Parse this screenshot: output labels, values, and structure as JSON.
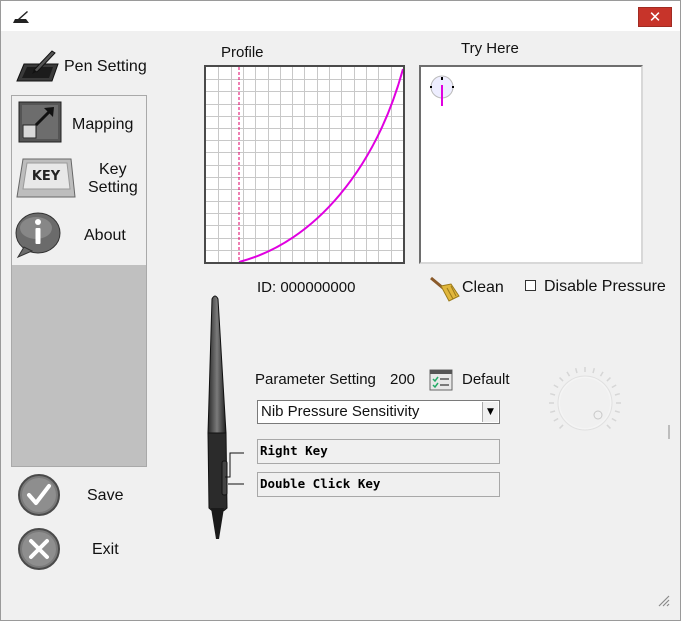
{
  "window": {
    "close_glyph": "✕"
  },
  "sidebar": {
    "items": [
      {
        "label": "Pen Setting",
        "icon": "tablet-pen-icon"
      },
      {
        "label": "Mapping",
        "icon": "mapping-icon"
      },
      {
        "label": "Key\nSetting",
        "label_line1": "Key",
        "label_line2": "Setting",
        "icon": "key-icon"
      },
      {
        "label": "About",
        "icon": "info-icon"
      }
    ],
    "save_label": "Save",
    "exit_label": "Exit"
  },
  "profile": {
    "title": "Profile"
  },
  "try_here": {
    "title": "Try Here"
  },
  "device": {
    "id_text": "ID: 000000000"
  },
  "clean_label": "Clean",
  "disable_pressure_label": "Disable Pressure",
  "parameter": {
    "label": "Parameter Setting",
    "value": "200",
    "default_label": "Default",
    "selected_option": "Nib Pressure Sensitivity"
  },
  "pen_keys": {
    "upper": "Right Key",
    "lower": "Double Click Key"
  },
  "colors": {
    "curve": "#e000e0",
    "close": "#c7342a",
    "grid": "#c8c8c8"
  }
}
